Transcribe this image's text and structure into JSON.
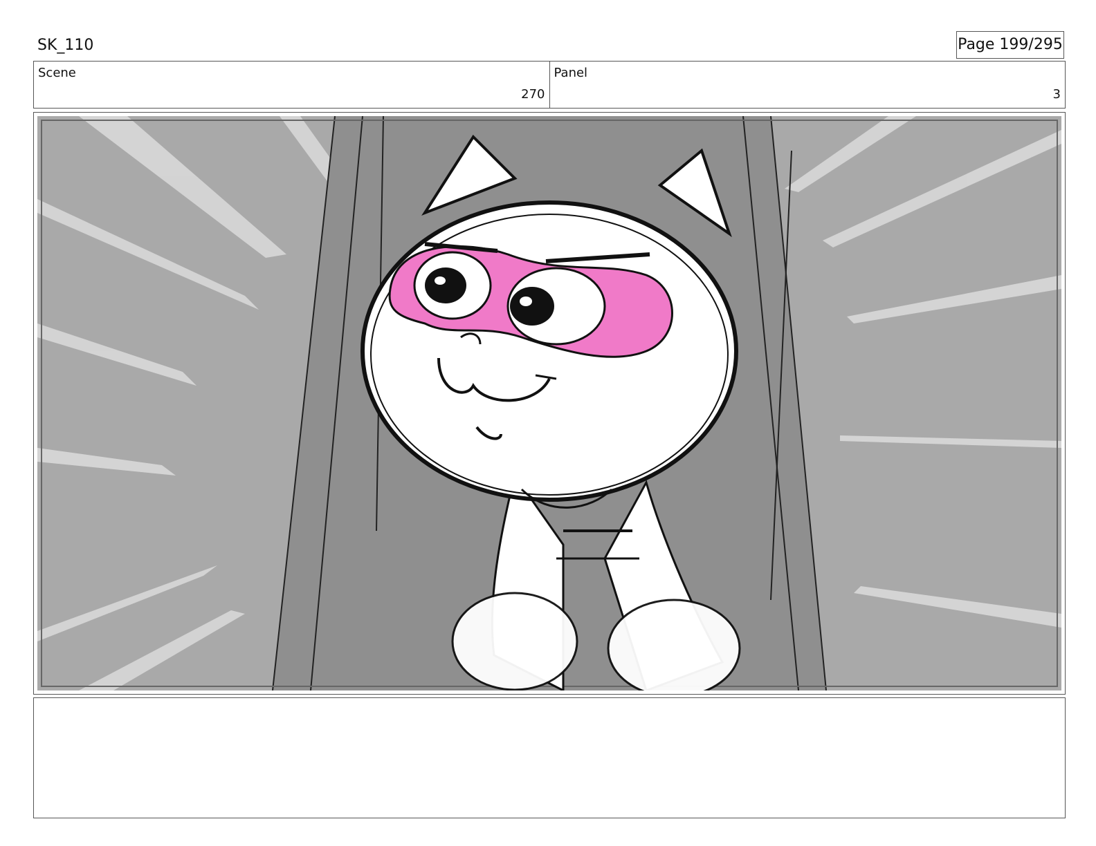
{
  "header": {
    "project_code": "SK_110",
    "page_label": "Page 199/295"
  },
  "scene": {
    "label": "Scene",
    "value": "270"
  },
  "panel": {
    "label": "Panel",
    "value": "3"
  },
  "artwork": {
    "description_icon": "storyboard-sketch-image",
    "colors": {
      "background_gray": "#a9a9a9",
      "wall_gray": "#8c8c8c",
      "mask_pink": "#f07ac8",
      "line": "#111111"
    }
  },
  "notes": {
    "text": ""
  }
}
